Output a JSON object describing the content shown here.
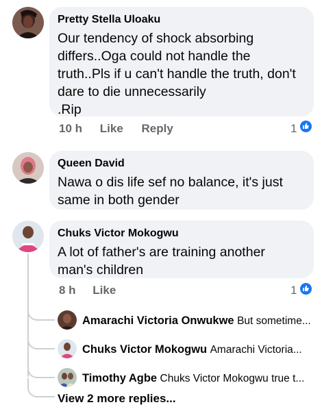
{
  "comments": [
    {
      "author": "Pretty Stella Uloaku",
      "text": "Our tendency of shock absorbing\ndiffers..Oga could not handle the\ntruth..Pls if u can't handle the truth, don't\ndare to die unnecessarily\n.Rip",
      "time": "10 h",
      "like_label": "Like",
      "reply_label": "Reply",
      "reaction_count": "1"
    },
    {
      "author": "Queen David",
      "text": "Nawa o dis life sef no balance, it's just\nsame in both gender"
    },
    {
      "author": "Chuks Victor Mokogwu",
      "text": "A lot of father's are training another\nman's children",
      "time": "8 h",
      "like_label": "Like",
      "reaction_count": "1"
    }
  ],
  "replies": [
    {
      "author": "Amarachi Victoria Onwukwe",
      "text": "But sometime..."
    },
    {
      "author": "Chuks Victor Mokogwu",
      "text": "Amarachi Victoria..."
    },
    {
      "author": "Timothy Agbe",
      "text": "Chuks Victor Mokogwu true t..."
    }
  ],
  "view_more_label": "View 2 more replies...",
  "colors": {
    "bubble": "#f0f2f5",
    "secondary_text": "#65676b",
    "like_blue": "#1877f2",
    "thread_line": "#ccd0d5"
  }
}
